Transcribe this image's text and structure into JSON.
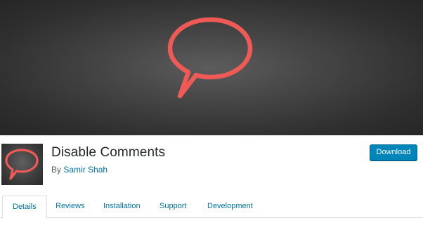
{
  "plugin": {
    "name": "Disable Comments",
    "by_prefix": "By",
    "author": "Samir Shah"
  },
  "actions": {
    "download_label": "Download"
  },
  "tabs": [
    {
      "label": "Details",
      "active": true
    },
    {
      "label": "Reviews",
      "active": false
    },
    {
      "label": "Installation",
      "active": false
    },
    {
      "label": "Support",
      "active": false
    },
    {
      "label": "Development",
      "active": false
    }
  ],
  "icons": {
    "banner": "speech-bubble-icon",
    "plugin": "speech-bubble-icon"
  },
  "colors": {
    "accent": "#0085ba",
    "link": "#0073aa",
    "bubble": "#ef5a56"
  }
}
